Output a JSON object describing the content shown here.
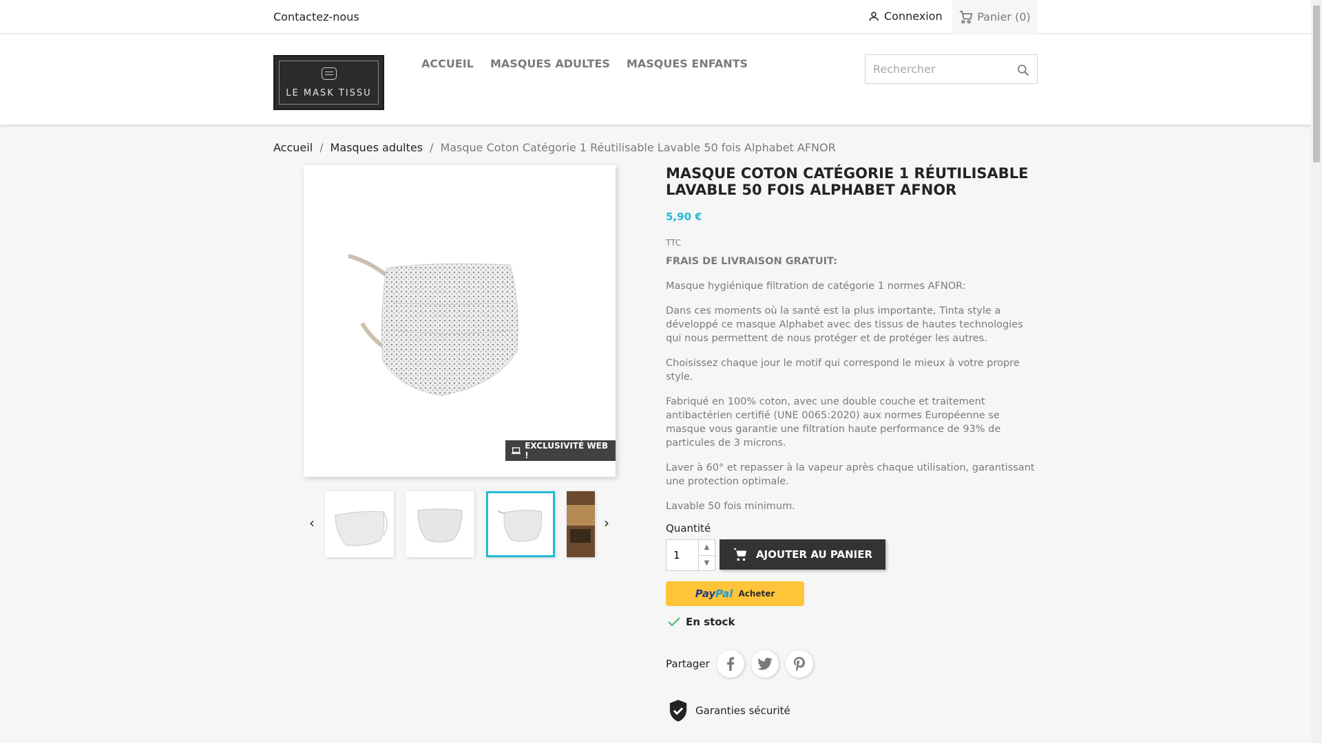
{
  "topbar": {
    "contact": "Contactez-nous",
    "login": "Connexion",
    "cart": "Panier (0)"
  },
  "header": {
    "logo_text": "LE MASK TISSU",
    "nav": [
      "Accueil",
      "Masques adultes",
      "Masques enfants"
    ],
    "search_placeholder": "Rechercher"
  },
  "breadcrumb": {
    "items": [
      "Accueil",
      "Masques adultes",
      "Masque Coton Catégorie 1 Réutilisable Lavable 50 fois Alphabet AFNOR"
    ],
    "separator": "/"
  },
  "gallery": {
    "badge": "EXCLUSIVITÉ WEB !"
  },
  "product": {
    "title": "Masque Coton Catégorie 1 Réutilisable Lavable 50 fois Alphabet AFNOR",
    "price": "5,90 €",
    "tax": "TTC",
    "description": [
      "FRAIS DE LIVRAISON GRATUIT:",
      "Masque hygiénique filtration de catégorie 1 normes AFNOR:",
      "Dans ces moments où la santé est la plus importante, Tinta style a développé ce masque Alphabet avec des tissus de hautes technologies qui nous permettent de nous protéger et de protéger les autres.",
      "Choisissez chaque jour le motif qui correspond le mieux à votre propre style.",
      "Fabriqué en 100% coton, avec une double couche et traitement antibactérien certifié (UNE 0065:2020) aux normes Européenne se masque vous garantie une filtration haute performance de 93% de particules de 3 microns.",
      "Laver à 60° et repasser à la vapeur après chaque utilisation, garantissant une protection optimale.",
      "Lavable 50 fois minimum."
    ],
    "quantity_label": "Quantité",
    "quantity_value": "1",
    "add_to_cart": "Ajouter au panier",
    "paypal_pay": "Pay",
    "paypal_pal": "Pal",
    "paypal_buy": "Acheter",
    "stock": "En stock",
    "share_label": "Partager",
    "security": "Garanties sécurité"
  },
  "colors": {
    "accent": "#24b9d7",
    "paypal": "#ffc439",
    "button": "#333333"
  }
}
